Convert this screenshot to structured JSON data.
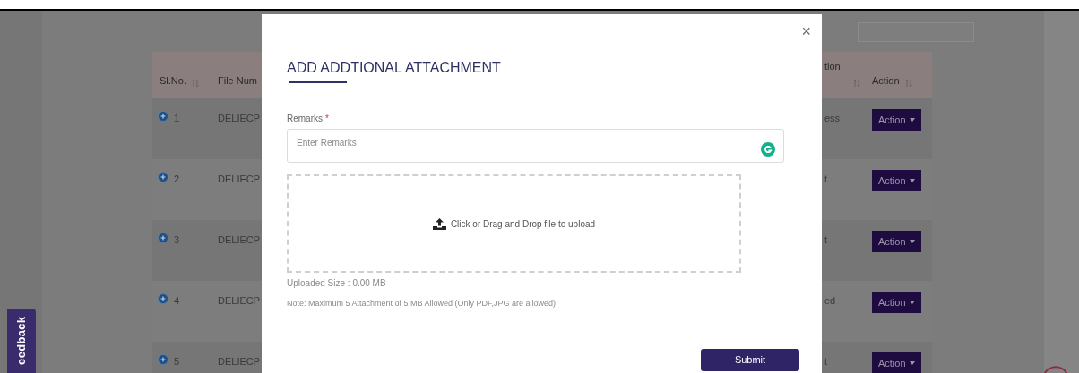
{
  "page": {
    "table": {
      "columns": [
        {
          "label": "Sl.No.",
          "sortable": true
        },
        {
          "label": "File Num",
          "sortable": false
        },
        {
          "label": "tion",
          "sortable": true
        },
        {
          "label": "Action",
          "sortable": true
        }
      ],
      "rows": [
        {
          "sl": "1",
          "file": "DELIECP",
          "status": "ess",
          "action": "Action"
        },
        {
          "sl": "2",
          "file": "DELIECP",
          "status": "t",
          "action": "Action"
        },
        {
          "sl": "3",
          "file": "DELIECP",
          "status": "t",
          "action": "Action"
        },
        {
          "sl": "4",
          "file": "DELIECP",
          "status": "ed",
          "action": "Action"
        },
        {
          "sl": "5",
          "file": "DELIECP",
          "status": "t",
          "action": "Action"
        }
      ]
    },
    "feedback_tab": "eedback"
  },
  "modal": {
    "close": "×",
    "title": "ADD ADDTIONAL ATTACHMENT",
    "remarks": {
      "label": "Remarks",
      "required_mark": "*",
      "placeholder": "Enter Remarks"
    },
    "dropzone": "Click or Drag and Drop file to upload",
    "uploaded_size": "Uploaded Size : 0.00  MB",
    "note": "Note: Maximum 5 Attachment of 5 MB Allowed (Only PDF,JPG are allowed)",
    "submit": "Submit"
  }
}
